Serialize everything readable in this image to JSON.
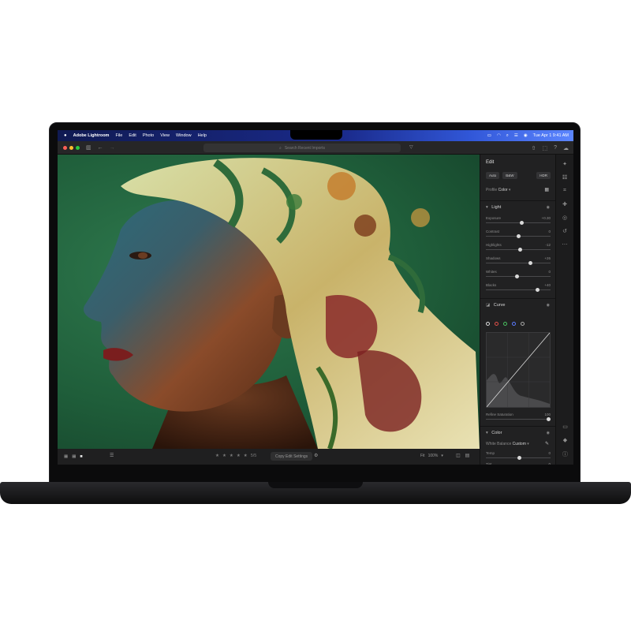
{
  "menubar": {
    "app_name": "Adobe Lightroom",
    "items": [
      "File",
      "Edit",
      "Photo",
      "View",
      "Window",
      "Help"
    ],
    "clock": "Tue Apr 1  9:41 AM"
  },
  "toolbar": {
    "search_placeholder": "Search Recent Imports"
  },
  "edit_panel": {
    "title": "Edit",
    "mode_auto": "Auto",
    "mode_bw": "B&W",
    "mode_hdr": "HDR",
    "profile_label": "Profile",
    "profile_value": "Color",
    "light": {
      "title": "Light",
      "sliders": [
        {
          "label": "Exposure",
          "value": "+0.30",
          "pos": 0.55
        },
        {
          "label": "Contrast",
          "value": "0",
          "pos": 0.5
        },
        {
          "label": "Highlights",
          "value": "-12",
          "pos": 0.53
        },
        {
          "label": "Shadows",
          "value": "+26",
          "pos": 0.69
        },
        {
          "label": "Whites",
          "value": "0",
          "pos": 0.48
        },
        {
          "label": "Blacks",
          "value": "+40",
          "pos": 0.8
        }
      ]
    },
    "curve": {
      "title": "Curve",
      "channel_label": "Refine Saturation",
      "channel_value": "100"
    },
    "color": {
      "title": "Color",
      "wb_label": "White Balance",
      "wb_value": "Custom",
      "sliders": [
        {
          "label": "Temp",
          "value": "0",
          "pos": 0.52
        },
        {
          "label": "Tint",
          "value": "0",
          "pos": 0.5
        }
      ]
    }
  },
  "bottom_bar": {
    "count": "5/5",
    "copy_label": "Copy Edit Settings",
    "fit_label": "Fit",
    "zoom_label": "100%"
  },
  "colors": {
    "close": "#ff5f57",
    "minimize": "#febc2e",
    "zoom": "#28c840",
    "panel_bg": "#212122"
  }
}
